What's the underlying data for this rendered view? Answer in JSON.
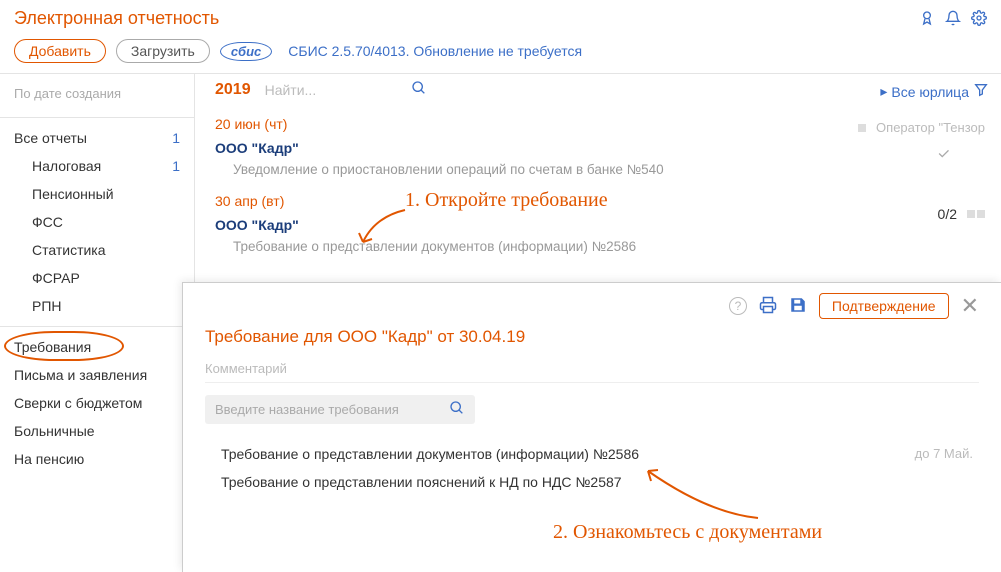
{
  "header": {
    "title": "Электронная отчетность"
  },
  "toolbar": {
    "add": "Добавить",
    "load": "Загрузить",
    "logo": "сбис",
    "version": "СБИС 2.5.70/4013. Обновление не требуется"
  },
  "sidebar": {
    "sort": "По дате создания",
    "items": [
      {
        "label": "Все отчеты",
        "count": "1",
        "indent": false
      },
      {
        "label": "Налоговая",
        "count": "1",
        "indent": true
      },
      {
        "label": "Пенсионный",
        "indent": true
      },
      {
        "label": "ФСС",
        "indent": true
      },
      {
        "label": "Статистика",
        "indent": true
      },
      {
        "label": "ФСРАР",
        "indent": true
      },
      {
        "label": "РПН",
        "indent": true
      },
      {
        "label": "Требования",
        "indent": false,
        "circled": true
      },
      {
        "label": "Письма и заявления",
        "indent": false
      },
      {
        "label": "Сверки с бюджетом",
        "indent": false
      },
      {
        "label": "Больничные",
        "indent": false
      },
      {
        "label": "На пенсию",
        "indent": false
      }
    ]
  },
  "main": {
    "year": "2019",
    "search_placeholder": "Найти...",
    "all_legal": "Все юрлица",
    "operator": "Оператор \"Тензор",
    "entries": [
      {
        "date": "20 июн (чт)",
        "org": "ООО \"Кадр\"",
        "desc": "Уведомление о приостановлении операций по счетам в банке №540"
      },
      {
        "date": "30 апр (вт)",
        "org": "ООО \"Кадр\"",
        "desc": "Требование о представлении документов (информации) №2586",
        "counter": "0/2"
      }
    ]
  },
  "annotations": {
    "a1": "1. Откройте требование",
    "a2": "2. Ознакомьтесь с документами"
  },
  "dialog": {
    "confirm": "Подтверждение",
    "title": "Требование для ООО \"Кадр\"  от 30.04.19",
    "comment": "Комментарий",
    "search_placeholder": "Введите название требования",
    "items": [
      {
        "text": "Требование о представлении документов (информации) №2586",
        "due": "до 7 Май."
      },
      {
        "text": "Требование о представлении пояснений к НД по НДС №2587"
      }
    ]
  }
}
